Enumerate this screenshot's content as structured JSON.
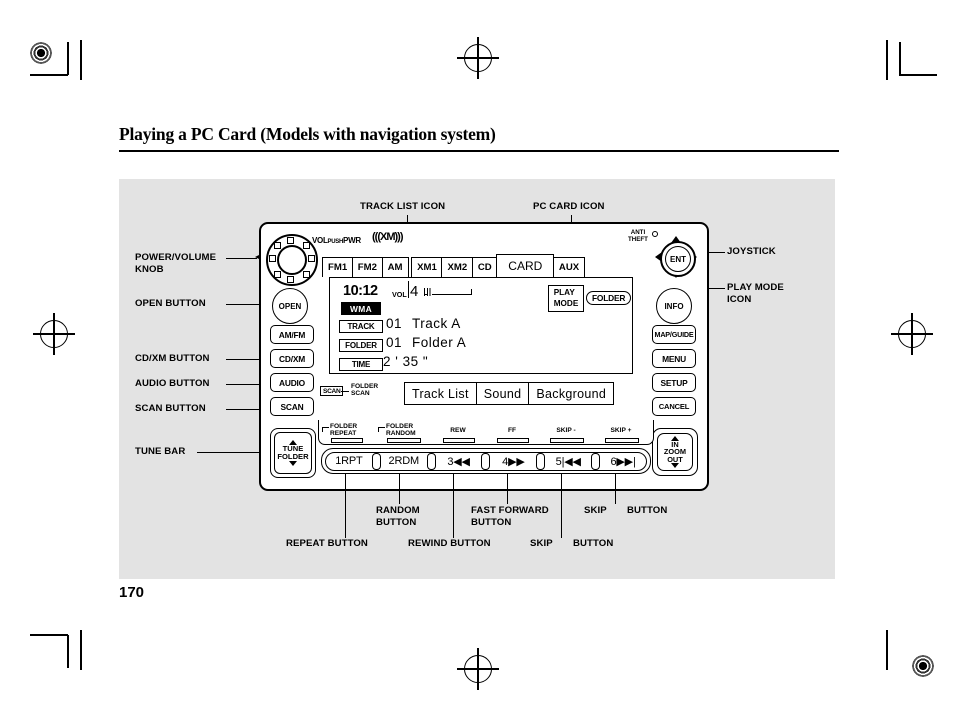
{
  "page": {
    "title": "Playing a PC Card (Models with navigation system)",
    "number": "170"
  },
  "callouts": {
    "top": [
      {
        "label": "TRACK LIST ICON"
      },
      {
        "label": "PC CARD ICON"
      }
    ],
    "left": [
      {
        "label": "POWER/VOLUME\nKNOB"
      },
      {
        "label": "OPEN BUTTON"
      },
      {
        "label": "CD/XM BUTTON"
      },
      {
        "label": "AUDIO BUTTON"
      },
      {
        "label": "SCAN BUTTON"
      },
      {
        "label": "TUNE BAR"
      }
    ],
    "right": [
      {
        "label": "JOYSTICK"
      },
      {
        "label": "PLAY MODE\nICON"
      }
    ],
    "bottom_upper": [
      {
        "label": "RANDOM\nBUTTON"
      },
      {
        "label": "FAST FORWARD\nBUTTON"
      },
      {
        "label": "SKIP"
      },
      {
        "label": "BUTTON"
      }
    ],
    "bottom_lower": [
      {
        "label": "REPEAT BUTTON"
      },
      {
        "label": "REWIND BUTTON"
      },
      {
        "label": "SKIP"
      },
      {
        "label": "BUTTON"
      }
    ]
  },
  "head_unit": {
    "knob_label_main": "VOL",
    "knob_label_push": "PUSH",
    "knob_label_pwr": "PWR",
    "xm_logo": "(((XM)))",
    "anti_theft": "ANTI\nTHEFT",
    "left_buttons": [
      {
        "label": "OPEN",
        "type": "round"
      },
      {
        "label": "AM/FM",
        "type": "pill"
      },
      {
        "label": "CD/XM",
        "type": "pill"
      },
      {
        "label": "AUDIO",
        "type": "pill"
      },
      {
        "label": "SCAN",
        "type": "pill"
      }
    ],
    "right_buttons": [
      {
        "label": "ENT",
        "type": "joystick"
      },
      {
        "label": "INFO",
        "type": "round"
      },
      {
        "label": "MAP/GUIDE",
        "type": "pill"
      },
      {
        "label": "MENU",
        "type": "pill"
      },
      {
        "label": "SETUP",
        "type": "pill"
      },
      {
        "label": "CANCEL",
        "type": "pill"
      }
    ],
    "tune_bar": {
      "label": "TUNE\nFOLDER",
      "up": "▲",
      "down": "▼"
    },
    "zoom_rocker": {
      "in": "IN",
      "label": "ZOOM",
      "out": "OUT"
    }
  },
  "screen": {
    "tabs": [
      {
        "label": "FM1",
        "selected": false
      },
      {
        "label": "FM2",
        "selected": false
      },
      {
        "label": "AM",
        "selected": false
      },
      {
        "label": "XM1",
        "selected": false
      },
      {
        "label": "XM2",
        "selected": false
      },
      {
        "label": "CD",
        "selected": false
      },
      {
        "label": "CARD",
        "selected": true
      },
      {
        "label": "AUX",
        "selected": false
      }
    ],
    "clock": "10:12",
    "vol_label": "VOL",
    "vol_value": "4",
    "format_badge": "WMA",
    "fields": [
      {
        "tag": "TRACK",
        "number": "01",
        "text": "Track A"
      },
      {
        "tag": "FOLDER",
        "number": "01",
        "text": "Folder A"
      },
      {
        "tag": "TIME",
        "number": "2 ' 35 \"",
        "text": ""
      }
    ],
    "play_mode_label": "PLAY\nMODE",
    "play_mode_value": "FOLDER",
    "scan_tag": "SCAN",
    "folder_scan_label": "FOLDER\nSCAN",
    "softkeys": [
      {
        "label": "Track  List"
      },
      {
        "label": "Sound"
      },
      {
        "label": "Background"
      }
    ]
  },
  "presets": {
    "function_labels": [
      {
        "label": "FOLDER\nREPEAT",
        "elbow": true
      },
      {
        "label": "FOLDER\nRANDOM",
        "elbow": true
      },
      {
        "label": "REW",
        "elbow": false
      },
      {
        "label": "FF",
        "elbow": false
      },
      {
        "label": "SKIP -",
        "elbow": false
      },
      {
        "label": "SKIP +",
        "elbow": false
      }
    ],
    "buttons": [
      {
        "num": "1",
        "label": "RPT"
      },
      {
        "num": "2",
        "label": "RDM"
      },
      {
        "num": "3",
        "label": "◀◀"
      },
      {
        "num": "4",
        "label": "▶▶"
      },
      {
        "num": "5",
        "label": "|◀◀"
      },
      {
        "num": "6",
        "label": "▶▶|"
      }
    ]
  }
}
